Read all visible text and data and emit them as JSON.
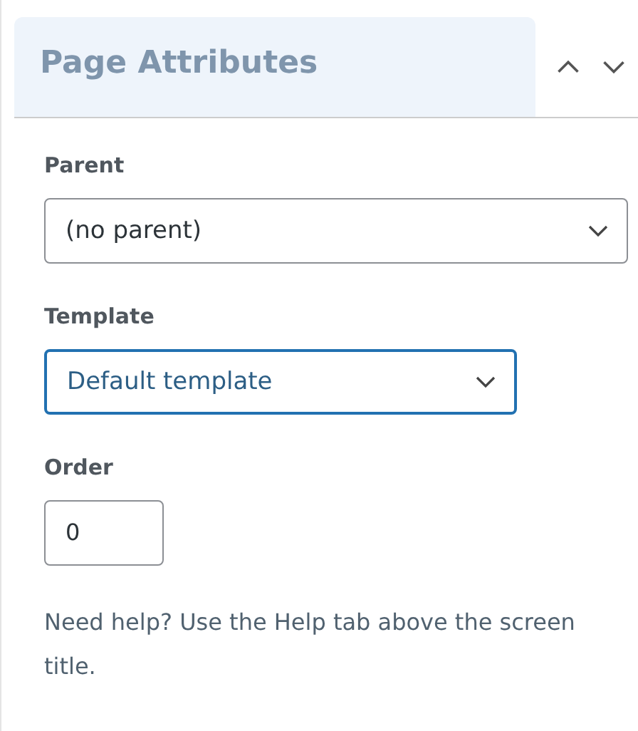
{
  "panel": {
    "title": "Page Attributes",
    "expanded": true
  },
  "fields": [
    {
      "kind": "select",
      "label": "Parent",
      "value": "(no parent)",
      "focused": false
    },
    {
      "kind": "select",
      "label": "Template",
      "value": "Default template",
      "focused": true
    },
    {
      "kind": "number",
      "label": "Order",
      "value": "0",
      "focused": false
    }
  ],
  "help_text": "Need help? Use the Help tab above the screen title."
}
